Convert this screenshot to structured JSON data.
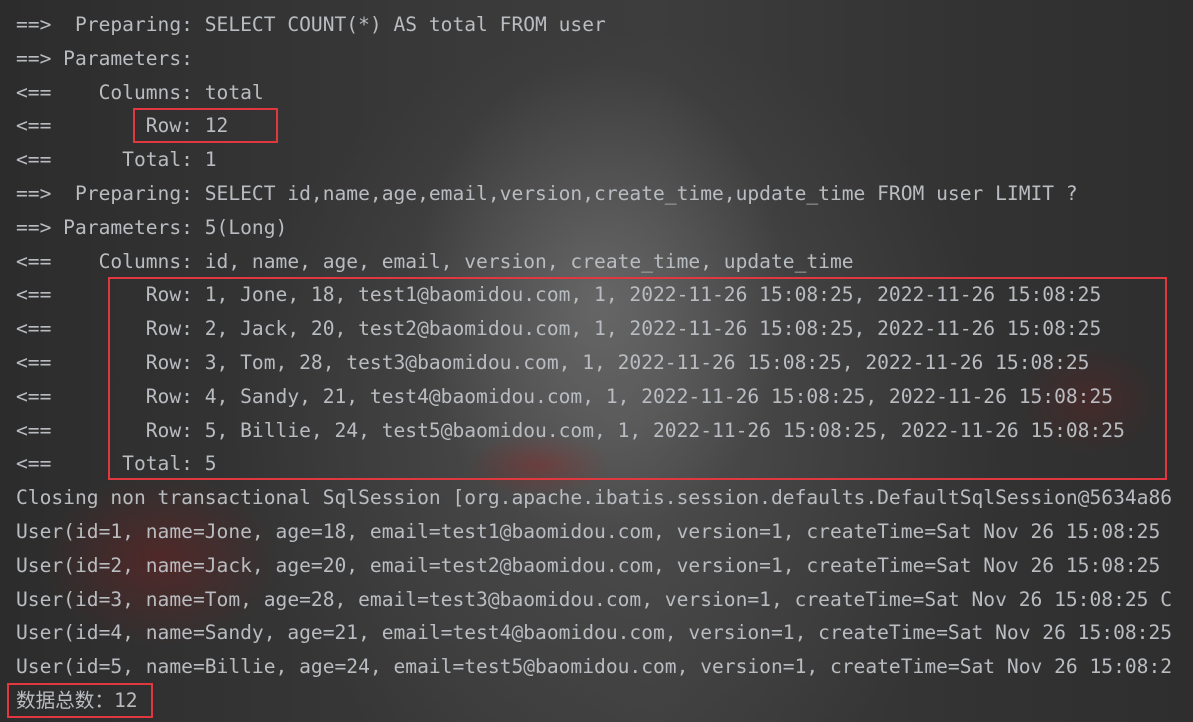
{
  "console": {
    "lines": [
      "==>  Preparing: SELECT COUNT(*) AS total FROM user",
      "==> Parameters: ",
      "<==    Columns: total",
      "<==        Row: 12",
      "<==      Total: 1",
      "==>  Preparing: SELECT id,name,age,email,version,create_time,update_time FROM user LIMIT ?",
      "==> Parameters: 5(Long)",
      "<==    Columns: id, name, age, email, version, create_time, update_time",
      "<==        Row: 1, Jone, 18, test1@baomidou.com, 1, 2022-11-26 15:08:25, 2022-11-26 15:08:25",
      "<==        Row: 2, Jack, 20, test2@baomidou.com, 1, 2022-11-26 15:08:25, 2022-11-26 15:08:25",
      "<==        Row: 3, Tom, 28, test3@baomidou.com, 1, 2022-11-26 15:08:25, 2022-11-26 15:08:25",
      "<==        Row: 4, Sandy, 21, test4@baomidou.com, 1, 2022-11-26 15:08:25, 2022-11-26 15:08:25",
      "<==        Row: 5, Billie, 24, test5@baomidou.com, 1, 2022-11-26 15:08:25, 2022-11-26 15:08:25",
      "<==      Total: 5",
      "Closing non transactional SqlSession [org.apache.ibatis.session.defaults.DefaultSqlSession@5634a86",
      "User(id=1, name=Jone, age=18, email=test1@baomidou.com, version=1, createTime=Sat Nov 26 15:08:25",
      "User(id=2, name=Jack, age=20, email=test2@baomidou.com, version=1, createTime=Sat Nov 26 15:08:25",
      "User(id=3, name=Tom, age=28, email=test3@baomidou.com, version=1, createTime=Sat Nov 26 15:08:25 C",
      "User(id=4, name=Sandy, age=21, email=test4@baomidou.com, version=1, createTime=Sat Nov 26 15:08:25",
      "User(id=5, name=Billie, age=24, email=test5@baomidou.com, version=1, createTime=Sat Nov 26 15:08:2",
      "数据总数：12"
    ]
  },
  "colors": {
    "console_text": "#b9bcc0",
    "highlight_box": "#e0383e",
    "background": "#2b2b2b"
  }
}
